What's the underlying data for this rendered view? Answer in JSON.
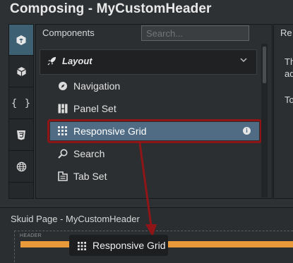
{
  "window": {
    "title": "Composing - MyCustomHeader"
  },
  "toolrail": {
    "items": [
      {
        "icon": "components-cube-icon",
        "active": true
      },
      {
        "icon": "box-icon",
        "active": false
      },
      {
        "icon": "braces-icon",
        "label": "{ }",
        "active": false
      },
      {
        "icon": "css3-icon",
        "active": false
      },
      {
        "icon": "globe-icon",
        "active": false
      }
    ]
  },
  "components_panel": {
    "title": "Components",
    "search_placeholder": "Search...",
    "group": {
      "label": "Layout",
      "icon": "rocket-icon",
      "expanded": true
    },
    "items": [
      {
        "label": "Navigation",
        "icon": "compass-icon"
      },
      {
        "label": "Panel Set",
        "icon": "panel-set-icon"
      },
      {
        "label": "Responsive Grid",
        "icon": "grid-icon",
        "selected": true,
        "info_icon": "info-icon"
      },
      {
        "label": "Search",
        "icon": "search-icon"
      },
      {
        "label": "Tab Set",
        "icon": "tab-set-icon"
      }
    ]
  },
  "right_panel": {
    "title": "Re",
    "line1": "Th",
    "line2": "ad",
    "line3": "To"
  },
  "page_area": {
    "title": "Skuid Page - MyCustomHeader",
    "zone_label": "HEADER",
    "drag_item": {
      "label": "Responsive Grid",
      "icon": "grid-icon"
    }
  },
  "colors": {
    "selected_bg": "#4f6c84",
    "annotation_red": "#8f1517",
    "header_bar": "#e89a3a",
    "active_tool": "#3d6073"
  }
}
